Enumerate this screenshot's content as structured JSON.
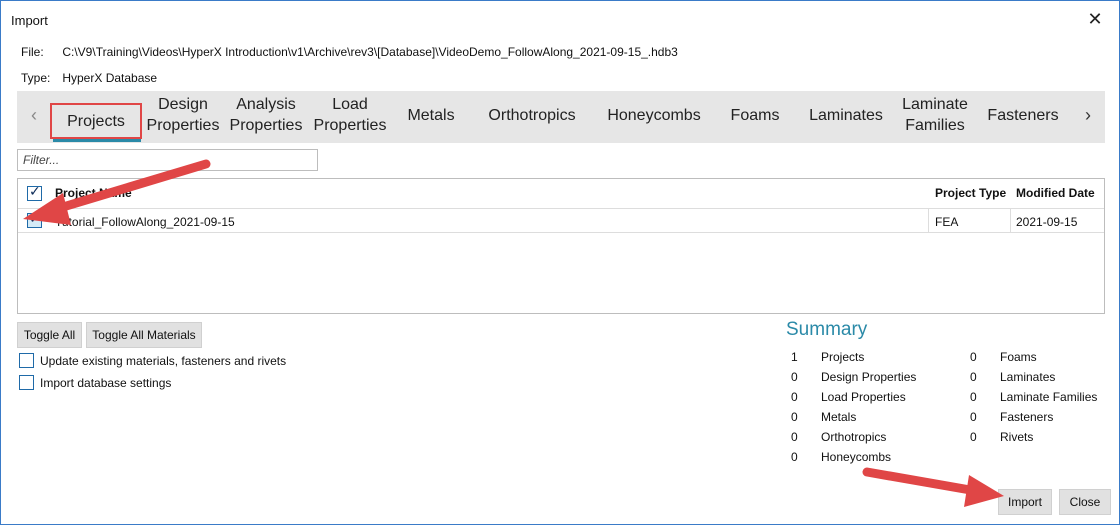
{
  "window": {
    "title": "Import",
    "close_glyph": "✕"
  },
  "file": {
    "label": "File:",
    "value": "C:\\V9\\Training\\Videos\\HyperX Introduction\\v1\\Archive\\rev3\\[Database]\\VideoDemo_FollowAlong_2021-09-15_.hdb3"
  },
  "type": {
    "label": "Type:",
    "value": "HyperX Database"
  },
  "tabs": {
    "left_arrow": "‹",
    "right_arrow": "›",
    "items": [
      {
        "label": "Projects"
      },
      {
        "label": "Design Properties"
      },
      {
        "label": "Analysis Properties"
      },
      {
        "label": "Load Properties"
      },
      {
        "label": "Metals"
      },
      {
        "label": "Orthotropics"
      },
      {
        "label": "Honeycombs"
      },
      {
        "label": "Foams"
      },
      {
        "label": "Laminates"
      },
      {
        "label": "Laminate Families"
      },
      {
        "label": "Fasteners"
      }
    ]
  },
  "filter": {
    "placeholder": "Filter..."
  },
  "grid": {
    "columns": [
      "Project Name",
      "Project Type",
      "Modified Date"
    ],
    "rows": [
      {
        "name": "Tutorial_FollowAlong_2021-09-15",
        "type": "FEA",
        "date": "2021-09-15",
        "checked": true
      }
    ]
  },
  "buttons": {
    "toggle_all": "Toggle All",
    "toggle_all_materials": "Toggle All Materials",
    "import": "Import",
    "close": "Close"
  },
  "options": {
    "update_existing": "Update existing materials, fasteners and rivets",
    "import_settings": "Import database settings"
  },
  "summary": {
    "title": "Summary",
    "left": [
      {
        "count": "1",
        "label": "Projects"
      },
      {
        "count": "0",
        "label": "Design Properties"
      },
      {
        "count": "0",
        "label": "Load Properties"
      },
      {
        "count": "0",
        "label": "Metals"
      },
      {
        "count": "0",
        "label": "Orthotropics"
      },
      {
        "count": "0",
        "label": "Honeycombs"
      }
    ],
    "right": [
      {
        "count": "0",
        "label": "Foams"
      },
      {
        "count": "0",
        "label": "Laminates"
      },
      {
        "count": "0",
        "label": "Laminate Families"
      },
      {
        "count": "0",
        "label": "Fasteners"
      },
      {
        "count": "0",
        "label": "Rivets"
      }
    ]
  },
  "colors": {
    "accent": "#2b8aa8",
    "annotation": "#e04646",
    "border": "#3a7bc8"
  }
}
